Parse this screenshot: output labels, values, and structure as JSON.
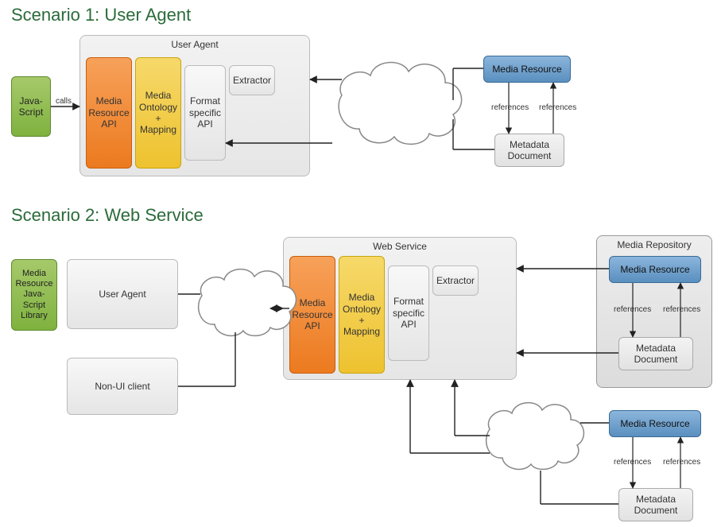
{
  "scenario1": {
    "title": "Scenario 1: User Agent",
    "javascript": "Java-\nScript",
    "calls": "calls",
    "user_agent_label": "User Agent",
    "media_resource_api": "Media\nResource\nAPI",
    "media_ontology_mapping": "Media\nOntology\n+\nMapping",
    "format_specific_api": "Format\nspecific\nAPI",
    "extractor": "Extractor",
    "media_resource": "Media Resource",
    "metadata_document": "Metadata\nDocument",
    "references": "references"
  },
  "scenario2": {
    "title": "Scenario 2: Web Service",
    "media_resource_js_library": "Media\nResource\nJava-\nScript\nLibrary",
    "user_agent": "User Agent",
    "non_ui_client": "Non-UI client",
    "web_service_label": "Web Service",
    "media_resource_api": "Media\nResource\nAPI",
    "media_ontology_mapping": "Media\nOntology\n+\nMapping",
    "format_specific_api": "Format\nspecific\nAPI",
    "extractor": "Extractor",
    "media_repository_label": "Media Repository",
    "media_resource": "Media Resource",
    "metadata_document": "Metadata\nDocument",
    "references": "references",
    "media_resource_2": "Media Resource",
    "metadata_document_2": "Metadata\nDocument"
  }
}
